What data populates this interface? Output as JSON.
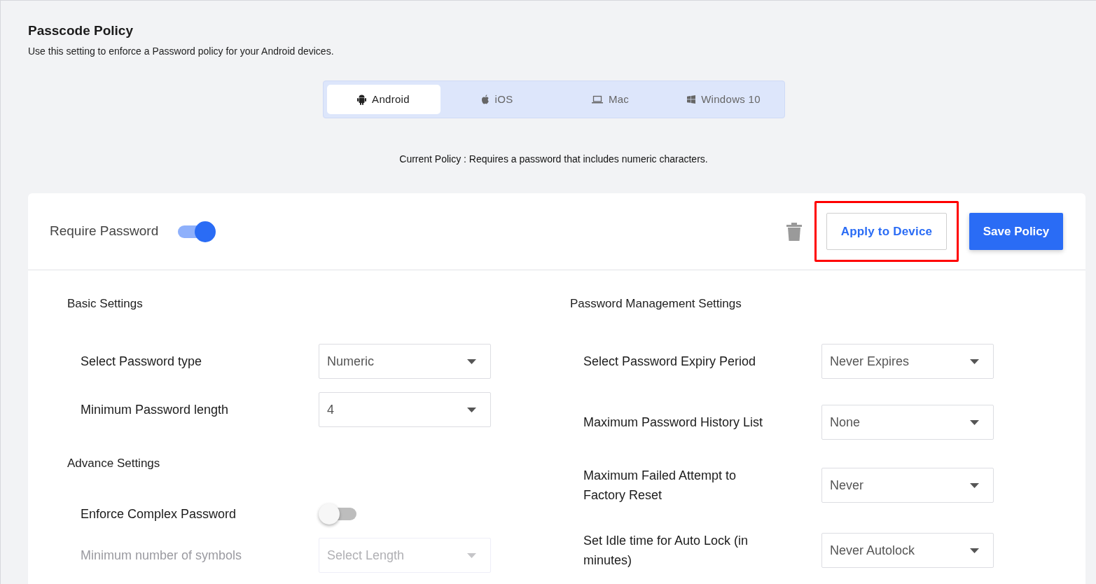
{
  "header": {
    "title": "Passcode Policy",
    "description": "Use this setting to enforce a Password policy for your Android devices."
  },
  "platform_tabs": [
    {
      "label": "Android",
      "selected": true
    },
    {
      "label": "iOS",
      "selected": false
    },
    {
      "label": "Mac",
      "selected": false
    },
    {
      "label": "Windows 10",
      "selected": false
    }
  ],
  "current_policy": "Current Policy : Requires a password that includes numeric characters.",
  "policy_card": {
    "require_password": {
      "label": "Require Password",
      "on": true
    },
    "actions": {
      "apply_button": "Apply to Device",
      "apply_highlighted": true,
      "save_button": "Save Policy"
    },
    "left_column": [
      {
        "kind": "heading",
        "label": "Basic Settings"
      },
      {
        "kind": "select",
        "label": "Select Password type",
        "value": "Numeric",
        "disabled": false
      },
      {
        "kind": "select",
        "label": "Minimum Password length",
        "value": "4",
        "disabled": false
      },
      {
        "kind": "heading",
        "label": "Advance Settings"
      },
      {
        "kind": "toggle",
        "label": "Enforce Complex Password",
        "on": false
      },
      {
        "kind": "select",
        "label": "Minimum number of symbols",
        "placeholder": "Select Length",
        "disabled": true
      }
    ],
    "right_column": [
      {
        "kind": "heading",
        "label": "Password Management Settings"
      },
      {
        "kind": "select",
        "label": "Select Password Expiry Period",
        "value": "Never Expires",
        "disabled": false
      },
      {
        "kind": "select",
        "label": "Maximum Password History List",
        "value": "None",
        "disabled": false
      },
      {
        "kind": "select",
        "label": "Maximum Failed Attempt to Factory Reset",
        "value": "Never",
        "disabled": false
      },
      {
        "kind": "select",
        "label": "Set Idle time for Auto Lock (in minutes)",
        "value": "Never Autolock",
        "disabled": false
      }
    ]
  }
}
